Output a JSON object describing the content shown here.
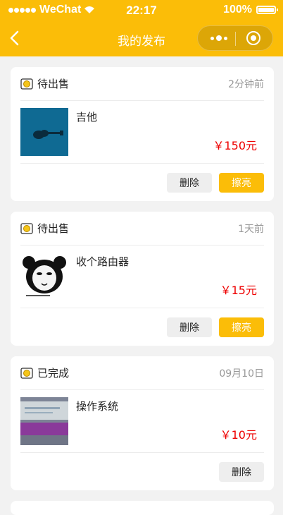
{
  "statusbar": {
    "carrier": "WeChat",
    "time": "22:17",
    "battery": "100%"
  },
  "navbar": {
    "title": "我的发布",
    "back_icon": "chevron-left-icon",
    "menu_icon": "more-dots-icon",
    "close_icon": "target-icon"
  },
  "colors": {
    "accent": "#fbbd08",
    "price": "#ee0000",
    "background": "#f2f2f2"
  },
  "items": [
    {
      "status": "待出售",
      "time": "2分钟前",
      "title": "吉他",
      "price": "￥150元",
      "thumb": "guitar-image",
      "actions": {
        "delete": "删除",
        "polish": "擦亮"
      }
    },
    {
      "status": "待出售",
      "time": "1天前",
      "title": "收个路由器",
      "price": "￥15元",
      "thumb": "panda-meme-image",
      "actions": {
        "delete": "删除",
        "polish": "擦亮"
      }
    },
    {
      "status": "已完成",
      "time": "09月10日",
      "title": "操作系统",
      "price": "￥10元",
      "thumb": "book-cover-image",
      "actions": {
        "delete": "删除"
      }
    }
  ]
}
